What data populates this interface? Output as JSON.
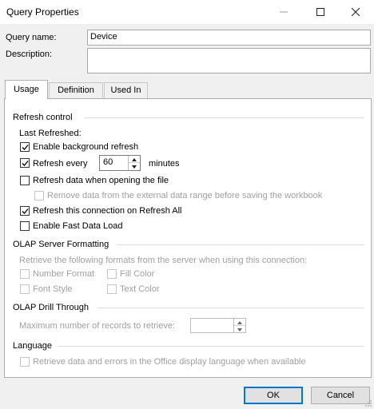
{
  "window": {
    "title": "Query Properties",
    "minimize_icon": "minimize-icon",
    "maximize_icon": "maximize-icon",
    "close_icon": "close-icon"
  },
  "query": {
    "name_label": "Query name:",
    "name_value": "Device",
    "description_label": "Description:",
    "description_value": ""
  },
  "tabs": [
    {
      "label": "Usage",
      "active": true
    },
    {
      "label": "Definition",
      "active": false
    },
    {
      "label": "Used In",
      "active": false
    }
  ],
  "refresh_control": {
    "heading": "Refresh control",
    "last_refreshed_label": "Last Refreshed:",
    "enable_background": {
      "label": "Enable background refresh",
      "checked": true
    },
    "refresh_every": {
      "label": "Refresh every",
      "checked": true,
      "value": "60",
      "unit": "minutes"
    },
    "refresh_on_open": {
      "label": "Refresh data when opening the file",
      "checked": false
    },
    "remove_data": {
      "label": "Remove data from the external data range before saving the workbook",
      "checked": false,
      "enabled": false
    },
    "refresh_all": {
      "label": "Refresh this connection on Refresh All",
      "checked": true
    },
    "fast_data_load": {
      "label": "Enable Fast Data Load",
      "checked": false
    }
  },
  "olap_formatting": {
    "heading": "OLAP Server Formatting",
    "description": "Retrieve the following formats from the server when using this connection:",
    "number_format": {
      "label": "Number Format",
      "checked": false
    },
    "fill_color": {
      "label": "Fill Color",
      "checked": false
    },
    "font_style": {
      "label": "Font Style",
      "checked": false
    },
    "text_color": {
      "label": "Text Color",
      "checked": false
    }
  },
  "olap_drill": {
    "heading": "OLAP Drill Through",
    "max_records_label": "Maximum number of records to retrieve:",
    "max_records_value": ""
  },
  "language": {
    "heading": "Language",
    "retrieve_language": {
      "label": "Retrieve data and errors in the Office display language when available",
      "checked": false
    }
  },
  "buttons": {
    "ok": "OK",
    "cancel": "Cancel"
  },
  "colors": {
    "accent": "#0078d7",
    "panel_bg": "#ffffff",
    "dialog_bg": "#f0f0f0",
    "disabled_text": "#a0a0a0"
  }
}
